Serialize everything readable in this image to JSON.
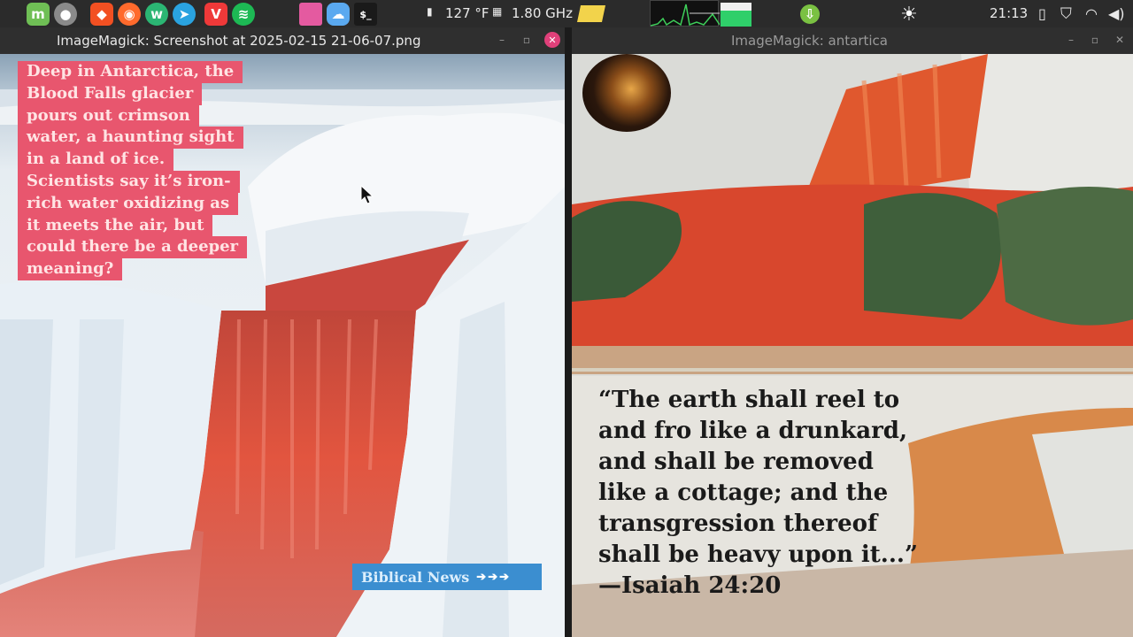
{
  "panel": {
    "cpu_temp": "127 °F",
    "cpu_freq": "1.80 GHz",
    "clock": "21:13"
  },
  "left_window": {
    "title": "ImageMagick: Screenshot at 2025-02-15 21-06-07.png",
    "caption_lines": [
      "Deep in Antarctica, the",
      "Blood Falls glacier",
      "pours out crimson",
      "water, a haunting sight",
      "in a land of ice.",
      "Scientists say it’s iron-",
      "rich water oxidizing as",
      "it meets the air, but",
      "could there be a deeper",
      "meaning?"
    ],
    "badge": "Biblical News",
    "badge_arrows": "➔➔➔"
  },
  "right_window": {
    "title": "ImageMagick: antartica",
    "quote_lines": [
      "“The earth shall reel to",
      "and fro like a drunkard,",
      "and shall be removed",
      "like a cottage; and the",
      "transgression thereof",
      "shall be heavy upon it...”",
      "—Isaiah 24:20"
    ]
  }
}
